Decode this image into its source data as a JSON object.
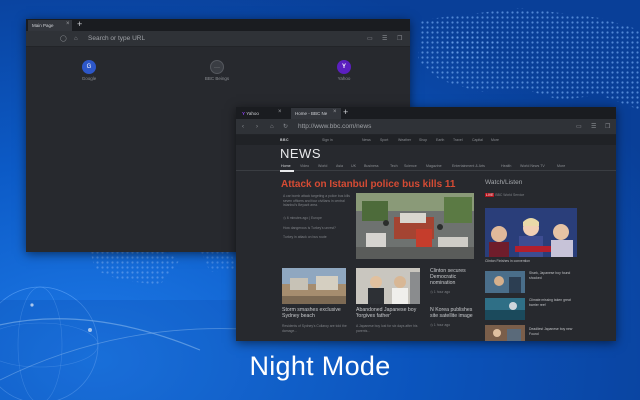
{
  "promo": {
    "caption": "Night Mode"
  },
  "window_back": {
    "tab_label": "Main Page",
    "address_placeholder": "Search or type URL",
    "speed_dials": [
      {
        "label": "Google",
        "glyph": "G"
      },
      {
        "label": "BBC Beings",
        "glyph": "···"
      },
      {
        "label": "Yahoo",
        "glyph": "Y"
      }
    ]
  },
  "window_front": {
    "tabs": [
      "Yahoo",
      "Home - BBC Ne"
    ],
    "url": "http://www.bbc.com/news",
    "top_nav": [
      "Sign in",
      "News",
      "Sport",
      "Weather",
      "Shop",
      "Earth",
      "Travel",
      "Capital",
      "More"
    ],
    "brand": "NEWS",
    "sections": [
      "Home",
      "Video",
      "World",
      "Asia",
      "UK",
      "Business",
      "Tech",
      "Science",
      "Magazine",
      "Entertainment & Arts",
      "Health",
      "World News TV",
      "More"
    ],
    "headline": "Attack on Istanbul police bus kills 11",
    "summary": "A car bomb attack targeting a police bus kills seven officers and four civilians in central Istanbul's Beyazit area.",
    "timestamp": "6 minutes ago | Europe",
    "related": [
      "How dangerous is Turkey's unrest?",
      "Turkey in attack on bus route"
    ],
    "watch_listen": {
      "title": "Watch/Listen",
      "live": "LIVE",
      "live_text": "BBC World Service",
      "caption": "Clinton Finishes in convention"
    },
    "stories": [
      {
        "title": "Storm smashes exclusive Sydney beach",
        "summary": "Residents of Sydney's Collaroy are told the damage..."
      },
      {
        "title": "Abandoned Japanese boy 'forgives father'",
        "summary": "A Japanese boy lost for six days after his parents..."
      },
      {
        "title": "Clinton secures Democratic nomination",
        "time": "1 hour ago",
        "secondary": "N Korea publishes site satellite image",
        "secondary_time": "1 hour ago"
      }
    ],
    "side_stories": [
      "Shark, Japanese boy found shocked",
      "Climate missing taken great barrier reef",
      "Deadliest Japanese boy new Found"
    ]
  }
}
